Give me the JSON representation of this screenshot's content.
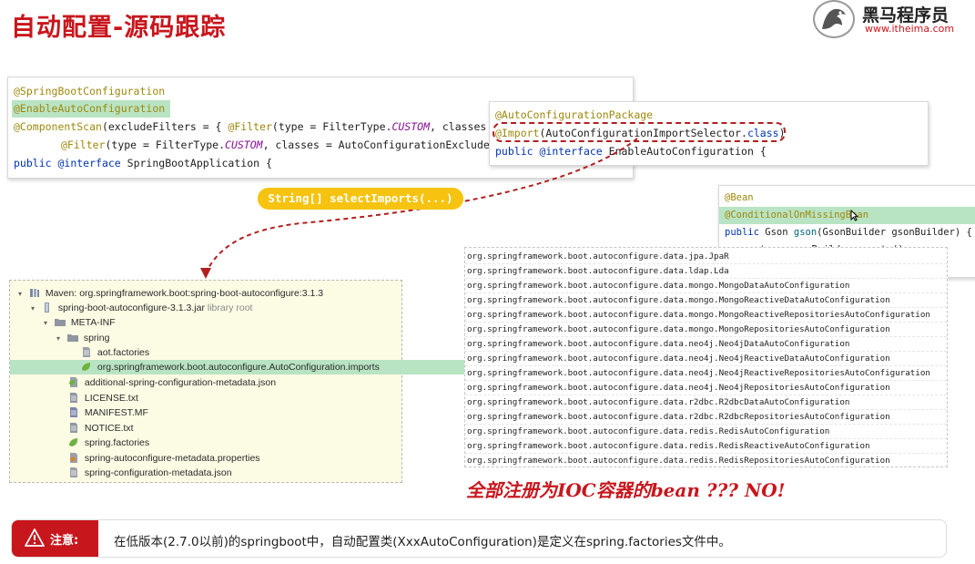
{
  "header": {
    "title": "自动配置-源码跟踪",
    "brand_name": "黑马程序员",
    "brand_url": "www.itheima.com"
  },
  "code_app": {
    "lines": [
      [
        "@SpringBootConfiguration"
      ],
      [
        "@EnableAutoConfiguration"
      ],
      [
        "@ComponentScan",
        "(excludeFilters = { ",
        "@Filter",
        "(type = FilterType.",
        "CUSTOM",
        ", classes = T"
      ],
      [
        "@Filter",
        "(type = FilterType.",
        "CUSTOM",
        ", classes = AutoConfigurationExcludeFil"
      ],
      [
        "public",
        " ",
        "@interface",
        " SpringBootApplication {"
      ]
    ]
  },
  "code_enable": {
    "lines": [
      [
        "@AutoConfigurationPackage"
      ],
      [
        "@Import",
        "(AutoConfigurationImportSelector.",
        "class",
        ")"
      ],
      [
        "public",
        " ",
        "@interface",
        " EnableAutoConfiguration {"
      ]
    ]
  },
  "code_bean": {
    "lines": [
      [
        "@Bean"
      ],
      [
        "@ConditionalOnMissingBean"
      ],
      [
        "public",
        " Gson ",
        "gson",
        "(GsonBuilder gsonBuilder) {"
      ],
      [
        "return",
        " gsonBuilder.create();"
      ],
      [
        "}"
      ]
    ]
  },
  "select_imports_label": "String[] selectImports(...)",
  "tree": {
    "items": [
      {
        "label": "Maven: org.springframework.boot:spring-boot-autoconfigure:3.1.3",
        "suffix": "",
        "icon": "library-icon",
        "arrow": "▾"
      },
      {
        "label": "spring-boot-autoconfigure-3.1.3.jar",
        "suffix": "library root",
        "icon": "jar-icon",
        "arrow": "▾"
      },
      {
        "label": "META-INF",
        "suffix": "",
        "icon": "folder-icon",
        "arrow": "▾"
      },
      {
        "label": "spring",
        "suffix": "",
        "icon": "folder-icon",
        "arrow": "▾"
      },
      {
        "label": "aot.factories",
        "suffix": "",
        "icon": "file-icon",
        "arrow": ""
      },
      {
        "label": "org.springframework.boot.autoconfigure.AutoConfiguration.imports",
        "suffix": "",
        "icon": "spring-file-icon",
        "arrow": ""
      },
      {
        "label": "additional-spring-configuration-metadata.json",
        "suffix": "",
        "icon": "json-file-icon",
        "arrow": ""
      },
      {
        "label": "LICENSE.txt",
        "suffix": "",
        "icon": "text-file-icon",
        "arrow": ""
      },
      {
        "label": "MANIFEST.MF",
        "suffix": "",
        "icon": "manifest-file-icon",
        "arrow": ""
      },
      {
        "label": "NOTICE.txt",
        "suffix": "",
        "icon": "text-file-icon",
        "arrow": ""
      },
      {
        "label": "spring.factories",
        "suffix": "",
        "icon": "spring-file-icon",
        "arrow": ""
      },
      {
        "label": "spring-autoconfigure-metadata.properties",
        "suffix": "",
        "icon": "properties-file-icon",
        "arrow": ""
      },
      {
        "label": "spring-configuration-metadata.json",
        "suffix": "",
        "icon": "json-file-icon",
        "arrow": ""
      }
    ]
  },
  "imports_list": [
    "org.springframework.boot.autoconfigure.data.jpa.JpaR",
    "org.springframework.boot.autoconfigure.data.ldap.Lda",
    "org.springframework.boot.autoconfigure.data.mongo.MongoDataAutoConfiguration",
    "org.springframework.boot.autoconfigure.data.mongo.MongoReactiveDataAutoConfiguration",
    "org.springframework.boot.autoconfigure.data.mongo.MongoReactiveRepositoriesAutoConfiguration",
    "org.springframework.boot.autoconfigure.data.mongo.MongoRepositoriesAutoConfiguration",
    "org.springframework.boot.autoconfigure.data.neo4j.Neo4jDataAutoConfiguration",
    "org.springframework.boot.autoconfigure.data.neo4j.Neo4jReactiveDataAutoConfiguration",
    "org.springframework.boot.autoconfigure.data.neo4j.Neo4jReactiveRepositoriesAutoConfiguration",
    "org.springframework.boot.autoconfigure.data.neo4j.Neo4jRepositoriesAutoConfiguration",
    "org.springframework.boot.autoconfigure.data.r2dbc.R2dbcDataAutoConfiguration",
    "org.springframework.boot.autoconfigure.data.r2dbc.R2dbcRepositoriesAutoConfiguration",
    "org.springframework.boot.autoconfigure.data.redis.RedisAutoConfiguration",
    "org.springframework.boot.autoconfigure.data.redis.RedisReactiveAutoConfiguration",
    "org.springframework.boot.autoconfigure.data.redis.RedisRepositoriesAutoConfiguration"
  ],
  "handwritten_note": "全部注册为IOC容器的bean ???    NO!",
  "note": {
    "tag_label": "注意:",
    "text": "在低版本(2.7.0以前)的springboot中，自动配置类(XxxAutoConfiguration)是定义在spring.factories文件中。"
  },
  "colors": {
    "brand_red": "#c8161d",
    "highlight_green": "#b9e4c3",
    "pill_yellow": "#f6c310",
    "tree_bg": "#fcfbe4"
  }
}
